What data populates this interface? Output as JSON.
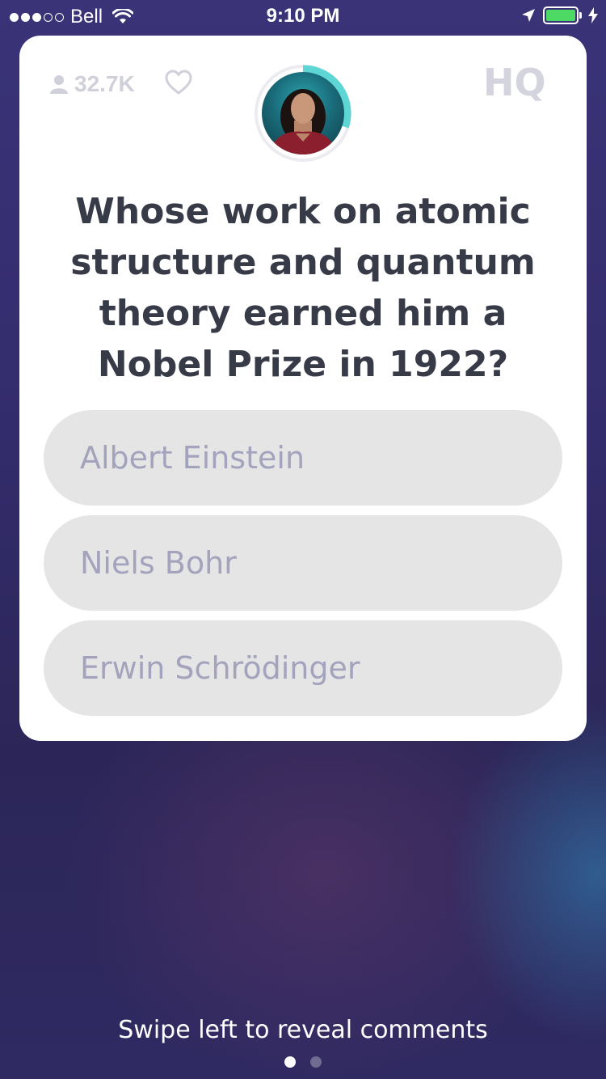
{
  "status_bar": {
    "signal_strength_of_5": 3,
    "carrier": "Bell",
    "time": "9:10 PM",
    "battery_fill": 1.0,
    "battery_color": "#4cd964",
    "icons": [
      "wifi-icon",
      "location-arrow-icon",
      "battery-icon",
      "charging-bolt-icon"
    ]
  },
  "header": {
    "viewers_count": "32.7K",
    "logo_text": "HQ",
    "icons": [
      "person-icon",
      "heart-icon"
    ]
  },
  "host": {
    "timer_progress": 0.3,
    "ring_color": "#5ed6d6"
  },
  "question": {
    "text": "Whose work on atomic structure and quantum theory earned him a Nobel Prize in 1922?"
  },
  "answers": [
    {
      "label": "Albert Einstein"
    },
    {
      "label": "Niels Bohr"
    },
    {
      "label": "Erwin Schrödinger"
    }
  ],
  "footer": {
    "hint": "Swipe left to reveal comments",
    "page_index": 0,
    "page_count": 2
  }
}
